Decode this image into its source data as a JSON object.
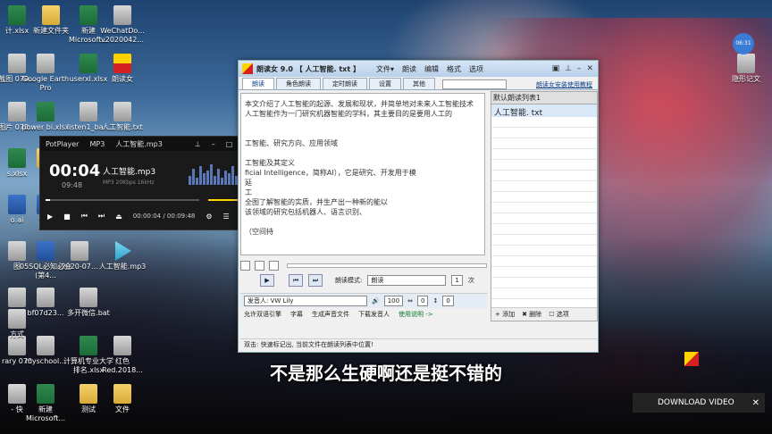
{
  "desktop": {
    "icons": [
      {
        "label": "计.xlsx",
        "type": "xls"
      },
      {
        "label": "新建文件夹",
        "type": "fold"
      },
      {
        "label": "新建 Microsoft...",
        "type": "xls"
      },
      {
        "label": "WeChatDo... v2020042...",
        "type": "gen"
      },
      {
        "label": "截图 070...",
        "type": "gen"
      },
      {
        "label": "Google Earth Pro",
        "type": "gen"
      },
      {
        "label": "userxl.xlsx",
        "type": "xls"
      },
      {
        "label": "朗读女",
        "type": "red"
      },
      {
        "label": "图片 070...",
        "type": "gen"
      },
      {
        "label": "power bi.xlsx",
        "type": "xls"
      },
      {
        "label": "listen1_ba...",
        "type": "gen"
      },
      {
        "label": "人工智能.txt",
        "type": "gen"
      },
      {
        "label": "s.xlsx",
        "type": "xls"
      },
      {
        "label": "ex",
        "type": "fold"
      },
      {
        "label": "o.ai",
        "type": "wrd"
      },
      {
        "label": "SQL",
        "type": "wrd"
      },
      {
        "label": "2020-07...",
        "type": "gen"
      },
      {
        "label": "05SQL必知必会 (第4...",
        "type": "wrd"
      },
      {
        "label": "人工智能.mp3",
        "type": "mp3"
      },
      {
        "label": "bf07d23...",
        "type": "gen"
      },
      {
        "label": "多开微信.bat",
        "type": "gen"
      },
      {
        "label": "rary 070",
        "type": "gen"
      },
      {
        "label": "myschool...",
        "type": "gen"
      },
      {
        "label": "计算机专业大学排名.xlsx",
        "type": "xls"
      },
      {
        "label": "红色 Red.2018...",
        "type": "gen"
      },
      {
        "label": "- 快",
        "type": "gen"
      },
      {
        "label": "新建 Microsoft...",
        "type": "xls"
      },
      {
        "label": "测试",
        "type": "fold"
      },
      {
        "label": "文件",
        "type": "fold"
      },
      {
        "label": "隐形记文",
        "type": "gen"
      },
      {
        "label": "图",
        "type": "gen"
      },
      {
        "label": "图",
        "type": "gen"
      },
      {
        "label": "方式",
        "type": "gen"
      }
    ],
    "clock": "06:31"
  },
  "potplayer": {
    "app": "PotPlayer",
    "format": "MP3",
    "title": "人工智能.mp3",
    "current": "00:04",
    "total": "09:48",
    "meta": "MP3   20Kbps   16kHz",
    "time_readout": "00:00:04 / 00:09:48",
    "progress": 0.007,
    "volume": 0.7,
    "eq_levels": [
      0.4,
      0.7,
      0.3,
      0.8,
      0.5,
      0.6,
      0.9,
      0.4,
      0.7,
      0.3,
      0.6,
      0.5,
      0.8,
      0.4,
      0.6,
      0.3
    ]
  },
  "reader": {
    "title": "朗读女 9.0 【 人工智能. txt 】",
    "menu": [
      "文件▾",
      "朗读",
      "编辑",
      "格式",
      "选项"
    ],
    "tabs": [
      "朗读",
      "角色朗读",
      "定时朗读",
      "设置",
      "其他"
    ],
    "help_link": "朗读女安装使用教程",
    "text_lines": [
      "本文介绍了人工智能的起源、发展和现状，并简单地对未来人工智能技术",
      "人工智能作为一门研究机器智能的学科，其主要目的是要用人工的",
      "",
      "",
      "工智能、研究方向、应用领域",
      "",
      "工智能及其定义",
      "ficial Intelligence，简称AI），它是研究、开发用于模",
      "延",
      "工",
      "全图了解智能的实质，并生产出一种新的能以",
      "该领域的研究包括机器人、语言识别、",
      "",
      "（空间持"
    ],
    "list_header": "默认朗读列表1",
    "list_items": [
      "人工智能. txt"
    ],
    "list_footer": [
      "+ 添加",
      "✖ 删除",
      "☐ 选项"
    ],
    "read_mode_label": "朗读模式:",
    "read_mode_value": "朗读",
    "repeat_value": "1",
    "repeat_unit": "次",
    "speaker": "发音人: VW Lily",
    "volume": "100",
    "rate": "0",
    "pitch": "0",
    "bottom_opts": [
      "允许双语引擎",
      "字幕",
      "生成声音文件",
      "下载发音人",
      "使用说明 ->"
    ],
    "status": "双击: 快速标记出, 当前文件在朗读列表中位置!"
  },
  "subtitle": "不是那么生硬啊还是挺不错的",
  "download_video": "DOWNLOAD VIDEO"
}
